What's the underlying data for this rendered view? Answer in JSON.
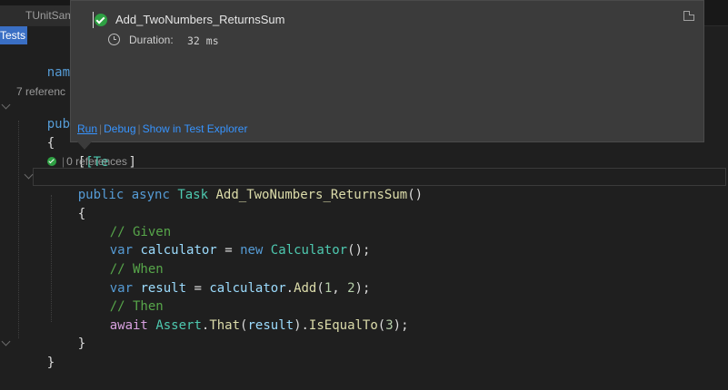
{
  "tabs": [
    {
      "label": ""
    },
    {
      "label": "TUnitSam"
    }
  ],
  "subbar": {
    "tests_label": "Tests"
  },
  "code": {
    "namespace_fragment": "namespa",
    "class_references": "7 referenc",
    "public_fragment": "public",
    "brace_open": "{",
    "attribute_fragment": "[Te",
    "attribute_close": "]",
    "method_references": "0 references",
    "method_kw_public": "public",
    "method_kw_async": "async",
    "method_type": "Task",
    "method_name": "Add_TwoNumbers_ReturnsSum",
    "method_parens": "()",
    "comment_given": "// Given",
    "comment_when": "// When",
    "comment_then": "// Then",
    "kw_var": "var",
    "kw_new": "new",
    "kw_await": "await",
    "var_calculator": "calculator",
    "var_result": "result",
    "type_calculator": "Calculator",
    "type_assert": "Assert",
    "method_add": "Add",
    "method_that": "That",
    "method_isequalto": "IsEqualTo",
    "num_1": "1",
    "num_2": "2",
    "num_3": "3",
    "brace_close": "}"
  },
  "popup": {
    "test_name": "Add_TwoNumbers_ReturnsSum",
    "status": "passed",
    "duration_label": "Duration:",
    "duration_value": "32 ms",
    "links": {
      "run": "Run",
      "debug": "Debug",
      "show": "Show in Test Explorer"
    }
  },
  "colors": {
    "background": "#1f1f1f",
    "keyword": "#569cd6",
    "type": "#4ec9b0",
    "method": "#dcdcaa",
    "comment": "#57a64a",
    "variable": "#9cdcfe",
    "number": "#b5cea8",
    "control": "#d8a0df",
    "link": "#3794ff",
    "passed": "#2ea043",
    "accent_tab": "#3a6fc4"
  }
}
